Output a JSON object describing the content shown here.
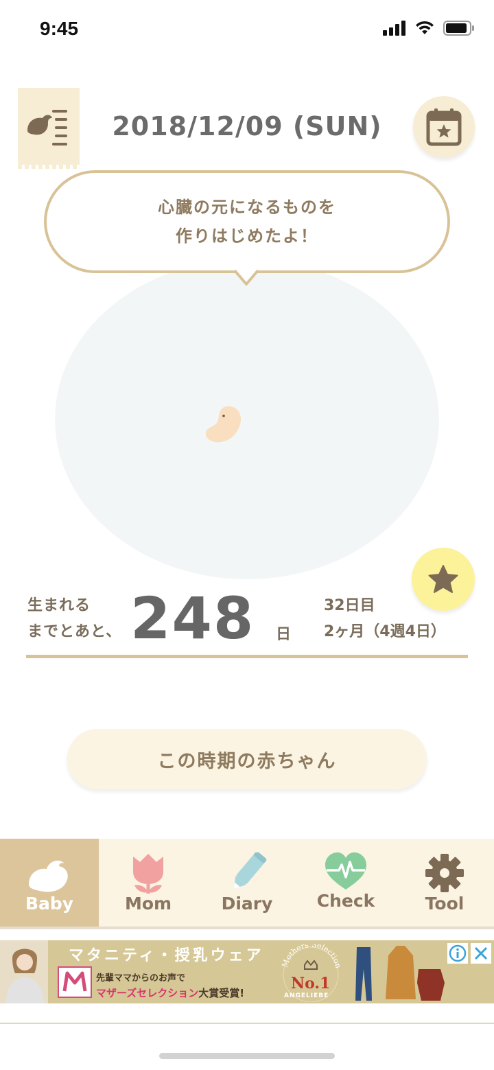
{
  "status_bar": {
    "time": "9:45"
  },
  "header": {
    "date": "2018/12/09 (SUN)"
  },
  "bubble": {
    "line1": "心臓の元になるものを",
    "line2": "作りはじめたよ！"
  },
  "countdown": {
    "label_line1": "生まれる",
    "label_line2": "までとあと、",
    "days": "248",
    "unit": "日",
    "info_line1": "32日目",
    "info_line2": "2ヶ月（4週4日）"
  },
  "baby_period_button": "この時期の赤ちゃん",
  "tabs": [
    {
      "label": "Baby",
      "icon": "bird-icon",
      "active": true
    },
    {
      "label": "Mom",
      "icon": "tulip-icon",
      "active": false
    },
    {
      "label": "Diary",
      "icon": "pencil-icon",
      "active": false
    },
    {
      "label": "Check",
      "icon": "heartbeat-icon",
      "active": false
    },
    {
      "label": "Tool",
      "icon": "gear-icon",
      "active": false
    }
  ],
  "ad": {
    "title": "マタニティ・授乳ウェア",
    "sub1": "先輩ママからのお声で",
    "sub2_highlight": "マザーズセレクション",
    "sub2_rest": "大賞受賞!",
    "seal_arc": "Mothers Selection",
    "seal_rank": "No.1",
    "seal_brand": "ANGELIEBE"
  },
  "colors": {
    "accent": "#d8c397",
    "tab_active": "#dcc59a",
    "cream": "#fbf4e2",
    "star_button": "#fbf29a"
  }
}
